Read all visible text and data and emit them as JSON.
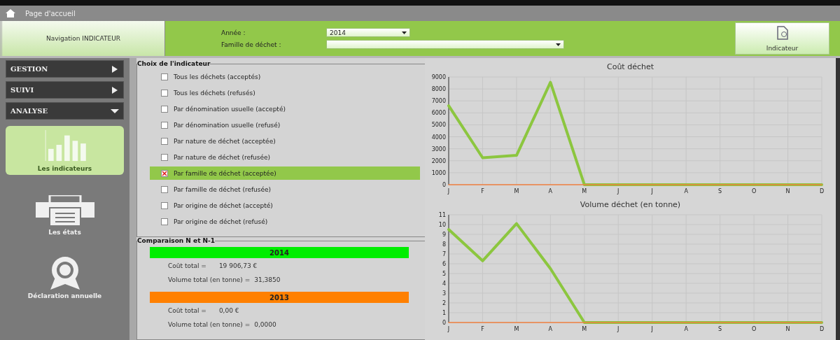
{
  "top_bar": {
    "title": "Page d'accueil"
  },
  "navigation": {
    "title": "Navigation INDICATEUR"
  },
  "filters": [
    {
      "label": "Année :",
      "value": "2014",
      "kind": "short"
    },
    {
      "label": "Famille de déchet :",
      "kind": "long"
    }
  ],
  "action_button": {
    "label": "Indicateur"
  },
  "sidebar": {
    "menus": [
      {
        "label": "GESTION",
        "expanded": false
      },
      {
        "label": "SUIVI",
        "expanded": false
      },
      {
        "label": "ANALYSE",
        "expanded": true
      }
    ],
    "items": [
      {
        "label": "Les indicateurs",
        "kind": "chart",
        "selected": true
      },
      {
        "label": "Les états",
        "kind": "printer",
        "selected": false
      },
      {
        "label": "Déclaration annuelle",
        "kind": "award",
        "selected": false
      }
    ]
  },
  "indicator_choice": {
    "title": "Choix de l'indicateur",
    "options": [
      {
        "label": "Tous les déchets (acceptés)",
        "checked": false
      },
      {
        "label": "Tous les déchets (refusés)",
        "checked": false
      },
      {
        "label": "Par dénomination usuelle (accepté)",
        "checked": false
      },
      {
        "label": "Par dénomination usuelle (refusé)",
        "checked": false
      },
      {
        "label": "Par nature de déchet (acceptée)",
        "checked": false
      },
      {
        "label": "Par nature de déchet (refusée)",
        "checked": false
      },
      {
        "label": "Par famille de déchet (acceptée)",
        "checked": true
      },
      {
        "label": "Par famille de déchet (refusée)",
        "checked": false
      },
      {
        "label": "Par origine de déchet (accepté)",
        "checked": false
      },
      {
        "label": "Par origine de déchet (refusé)",
        "checked": false
      }
    ]
  },
  "comparison": {
    "title": "Comparaison N et N-1",
    "years": [
      {
        "year": "2014",
        "color": "#00ee00",
        "cost_label": "Coût total =",
        "cost": "19 906,73 €",
        "volume_label": "Volume total (en tonne) =",
        "volume": "31,3850"
      },
      {
        "year": "2013",
        "color": "#ff8000",
        "cost_label": "Coût total =",
        "cost": "0,00 €",
        "volume_label": "Volume total (en tonne) =",
        "volume": "0,0000"
      }
    ]
  },
  "charts": [
    {
      "chart_data": {
        "type": "line",
        "grid": true,
        "title": "Coût déchet",
        "categories": [
          "J",
          "F",
          "M",
          "A",
          "M",
          "J",
          "J",
          "A",
          "S",
          "O",
          "N",
          "D"
        ],
        "ylim": [
          0,
          9000
        ],
        "yticks": [
          0,
          1000,
          2000,
          3000,
          4000,
          5000,
          6000,
          7000,
          8000,
          9000
        ],
        "series": [
          {
            "color": "#8cc63f",
            "values": [
              6600,
              2250,
              2450,
              8550,
              0,
              0,
              0,
              0,
              0,
              0,
              0,
              0
            ]
          },
          {
            "color": "#f08040",
            "values": [
              0,
              0,
              0,
              0,
              0,
              0,
              0,
              0,
              0,
              0,
              0,
              0
            ]
          }
        ]
      }
    },
    {
      "chart_data": {
        "type": "line",
        "grid": true,
        "title": "Volume déchet (en tonne)",
        "categories": [
          "J",
          "F",
          "M",
          "A",
          "M",
          "J",
          "J",
          "A",
          "S",
          "O",
          "N",
          "D"
        ],
        "ylim": [
          0,
          11
        ],
        "yticks": [
          0,
          1,
          2,
          3,
          4,
          5,
          6,
          7,
          8,
          9,
          10,
          11
        ],
        "series": [
          {
            "color": "#8cc63f",
            "values": [
              9.5,
              6.3,
              10.1,
              5.5,
              0,
              0,
              0,
              0,
              0,
              0,
              0,
              0
            ]
          },
          {
            "color": "#f08040",
            "values": [
              0,
              0,
              0,
              0,
              0,
              0,
              0,
              0,
              0,
              0,
              0,
              0
            ]
          }
        ]
      }
    }
  ]
}
